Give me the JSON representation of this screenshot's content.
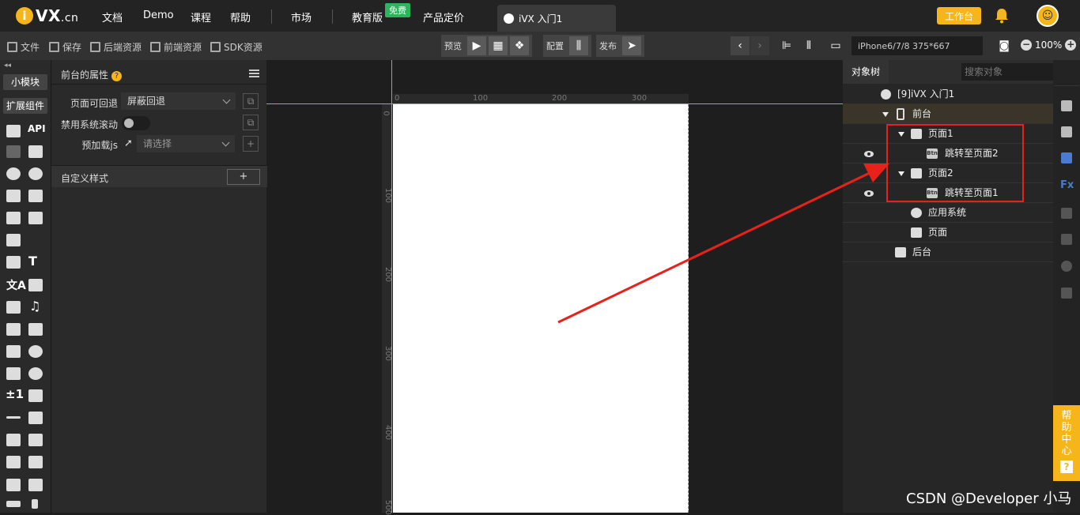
{
  "topbar": {
    "logo_letter": "i",
    "logo_text": "VX",
    "logo_suffix": ".cn",
    "nav": [
      "文档",
      "Demo",
      "课程",
      "帮助",
      "市场",
      "教育版",
      "产品定价"
    ],
    "free_badge": "免费",
    "active_tab": "iVX 入门1",
    "workbench_label": "工作台"
  },
  "toolbar": {
    "file": "文件",
    "save": "保存",
    "backend_res": "后端资源",
    "frontend_res": "前端资源",
    "sdk_res": "SDK资源",
    "preview": "预览",
    "config": "配置",
    "publish": "发布",
    "device": "iPhone6/7/8 375*667",
    "zoom": "100%"
  },
  "left": {
    "small_module": "小模块",
    "extend_components": "扩展组件",
    "api_label": "API"
  },
  "props": {
    "title": "前台的属性",
    "back_label": "页面可回退",
    "back_value": "屏蔽回退",
    "scroll_label": "禁用系统滚动",
    "preload_label": "预加载js",
    "preload_placeholder": "请选择",
    "custom_style": "自定义样式",
    "add": "+"
  },
  "ruler": {
    "h": [
      "0",
      "100",
      "200",
      "300"
    ],
    "v": [
      "0",
      "100",
      "200",
      "300",
      "400",
      "500"
    ]
  },
  "tree": {
    "tab": "对象树",
    "search_placeholder": "搜索对象",
    "root": "[9]iVX 入门1",
    "front": "前台",
    "page1": "页面1",
    "jump2": "跳转至页面2",
    "page2": "页面2",
    "jump1": "跳转至页面1",
    "app_system": "应用系统",
    "page": "页面",
    "backend": "后台"
  },
  "help_center": {
    "label": "帮助中心",
    "q": "?"
  },
  "watermark": "CSDN @Developer 小马",
  "colors": {
    "accent": "#f6b51b",
    "annotation": "#e8221b",
    "guide": "#38c9d8"
  }
}
